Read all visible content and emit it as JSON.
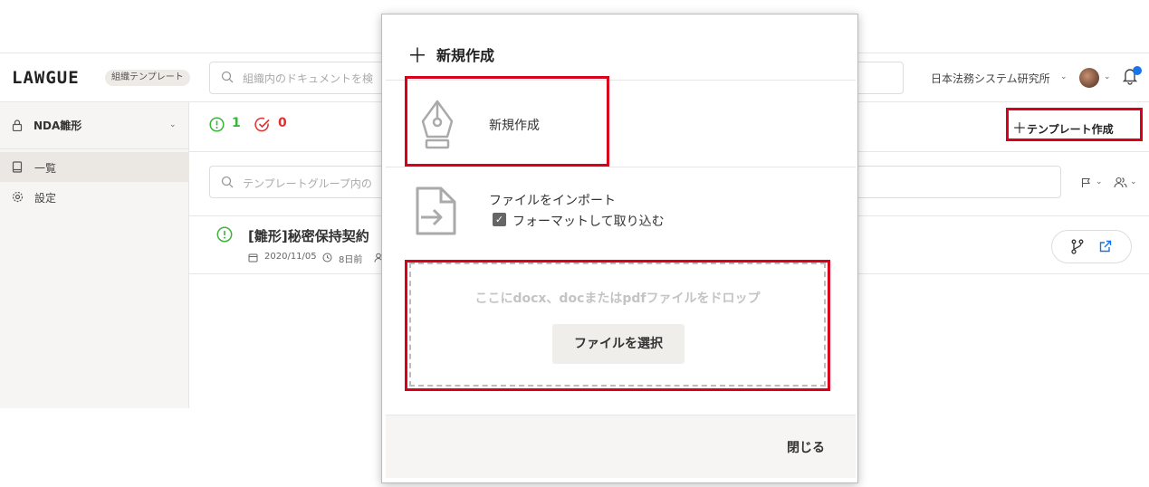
{
  "header": {
    "logo": "LAWGUE",
    "org_badge": "組織テンプレート",
    "search_placeholder": "組織内のドキュメントを検",
    "org_name": "日本法務システム研究所"
  },
  "sidebar": {
    "group_label": "NDA雛形",
    "items": [
      {
        "label": "一覧",
        "icon": "book-icon"
      },
      {
        "label": "設定",
        "icon": "gear-icon"
      }
    ]
  },
  "main": {
    "open_count": "1",
    "done_count": "0",
    "create_template_label": "テンプレート作成",
    "search_placeholder": "テンプレートグループ内の",
    "row": {
      "title": "[雛形]秘密保持契約",
      "date": "2020/11/05",
      "relative": "8日前"
    }
  },
  "modal": {
    "title": "新規作成",
    "new_label": "新規作成",
    "import_label": "ファイルをインポート",
    "format_label": "フォーマットして取り込む",
    "format_checked": true,
    "drop_hint": "ここにdocx、docまたはpdfファイルをドロップ",
    "select_file": "ファイルを選択",
    "close": "閉じる"
  },
  "colors": {
    "highlight": "#d9001b",
    "open_status": "#3cb43c",
    "done_status": "#e03030",
    "link": "#1a73e8"
  }
}
